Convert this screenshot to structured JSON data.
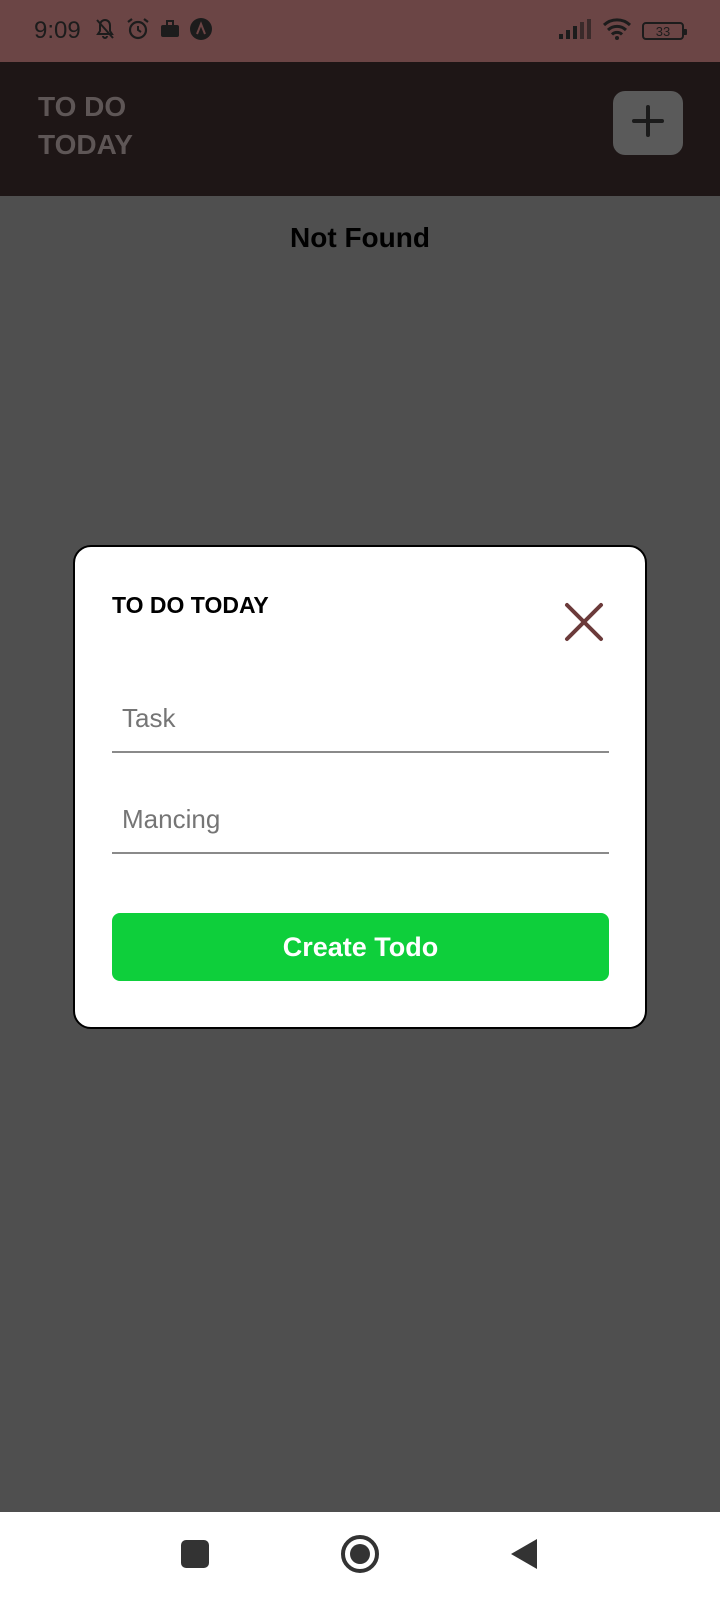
{
  "status_bar": {
    "time": "9:09",
    "battery": "33",
    "icons": [
      "notifications-off-icon",
      "alarm-icon",
      "briefcase-icon",
      "app-a-icon",
      "signal-icon",
      "wifi-icon",
      "battery-icon"
    ]
  },
  "header": {
    "title": "TO DO TODAY",
    "add_icon": "plus-icon"
  },
  "main": {
    "empty_message": "Not Found"
  },
  "modal": {
    "title": "TO DO TODAY",
    "close_icon": "close-icon",
    "fields": [
      {
        "value": "",
        "placeholder": "Task"
      },
      {
        "value": "",
        "placeholder": "Mancing"
      }
    ],
    "submit_label": "Create Todo"
  },
  "nav": {
    "icons": [
      "recents-square-icon",
      "home-circle-icon",
      "back-triangle-icon"
    ]
  },
  "colors": {
    "status_bar": "#6b4545",
    "header": "#1e1616",
    "overlay": "#4f4f4f",
    "accent_green": "#0ecf3b",
    "close_icon": "#6b3a3a"
  }
}
